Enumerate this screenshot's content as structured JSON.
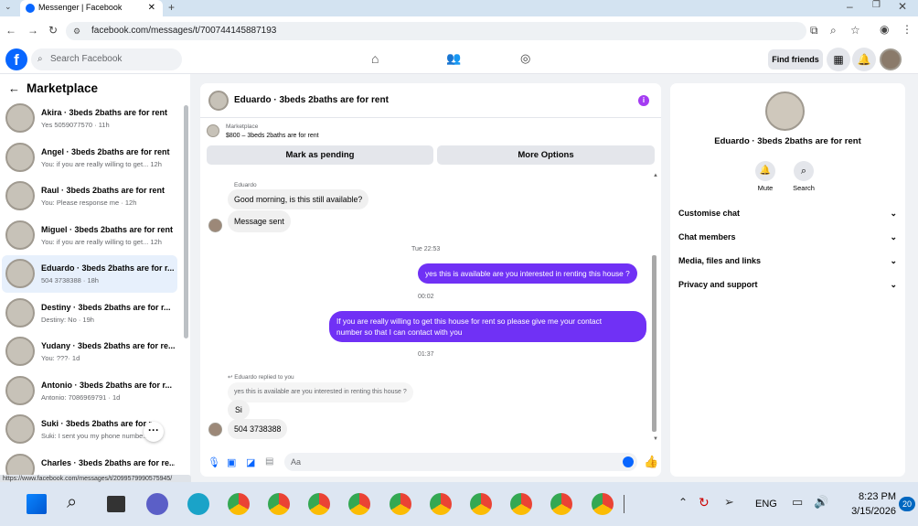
{
  "browser": {
    "tab_title": "Messenger | Facebook",
    "url": "facebook.com/messages/t/7007441458871​93",
    "status_url": "https://www.facebook.com/messages/t/2099579990575945/"
  },
  "fb": {
    "search_placeholder": "Search Facebook",
    "find_friends": "Find friends"
  },
  "sidebar": {
    "title": "Marketplace",
    "conversations": [
      {
        "name": "Akira · 3beds 2baths are for rent",
        "preview": "Yes 5059077570 · 11h"
      },
      {
        "name": "Angel · 3beds 2baths are for rent",
        "preview": "You: if you are really willing to get...  12h"
      },
      {
        "name": "Raul · 3beds 2baths are for rent",
        "preview": "You: Please response me · 12h"
      },
      {
        "name": "Miguel · 3beds 2baths are for rent",
        "preview": "You: if you are really willing to get...  12h"
      },
      {
        "name": "Eduardo · 3beds 2baths are for r...",
        "preview": "504 3738388 · 18h"
      },
      {
        "name": "Destiny · 3beds 2baths are for r...",
        "preview": "Destiny: No · 19h"
      },
      {
        "name": "Yudany · 3beds 2baths are for re...",
        "preview": "You: ???· 1d"
      },
      {
        "name": "Antonio · 3beds 2baths are for r...",
        "preview": "Antonio: 7086969791 · 1d"
      },
      {
        "name": "Suki · 3beds 2baths are for r...",
        "preview": "Suki: I sent you my phone numbe... 1d"
      },
      {
        "name": "Charles · 3beds 2baths are for re...",
        "preview": ""
      }
    ]
  },
  "chat": {
    "header_title": "Eduardo · 3beds 2baths are for rent",
    "listing_label": "Marketplace",
    "listing_price": "$800 – 3beds 2baths are for rent",
    "mark_pending": "Mark as pending",
    "more_options": "More Options",
    "sender_label": "Eduardo",
    "msg1": "Good morning, is this still available?",
    "msg2": "Message sent",
    "ts1": "Tue 22:53",
    "msg3": "yes this is available are you interested in renting this house ?",
    "ts2": "00:02",
    "msg4a": "If you are really willing to get this house for rent so please give me your contact",
    "msg4b": "number so that I  can contact with you",
    "ts3": "01:37",
    "replied_label": "Eduardo replied to you",
    "quoted": "yes this is available are you interested in renting this house ?",
    "msg5": "Si",
    "msg6": "504 3738388",
    "composer_placeholder": "Aa"
  },
  "right": {
    "name": "Eduardo · 3beds 2baths are for rent",
    "mute": "Mute",
    "search": "Search",
    "rows": [
      "Customise chat",
      "Chat members",
      "Media, files and links",
      "Privacy and support"
    ]
  },
  "taskbar": {
    "lang": "ENG",
    "time": "8:23 PM",
    "date": "3/15/2026",
    "badge": "20"
  },
  "colors": {
    "accent": "#7031f5",
    "fb_blue": "#0866ff"
  }
}
